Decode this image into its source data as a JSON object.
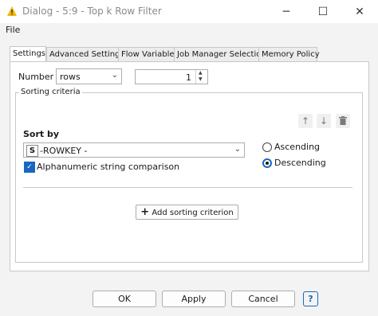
{
  "window": {
    "title": "Dialog - 5:9 - Top k Row Filter",
    "minimize": "─",
    "maximize": "☐",
    "close": "✕"
  },
  "menu": {
    "file": "File"
  },
  "tabs": [
    {
      "label": "Settings"
    },
    {
      "label": "Advanced Settings"
    },
    {
      "label": "Flow Variables"
    },
    {
      "label": "Job Manager Selection"
    },
    {
      "label": "Memory Policy"
    }
  ],
  "settings": {
    "number_of_label": "Number of",
    "number_of_unit": "rows",
    "number_value": "1",
    "sorting_criteria_title": "Sorting criteria",
    "sort_by_label": "Sort by",
    "sort_column_type": "S",
    "sort_column": "-ROWKEY -",
    "alphanumeric_label": "Alphanumeric string comparison",
    "alphanumeric_checked": true,
    "ascending_label": "Ascending",
    "descending_label": "Descending",
    "selected_order": "Descending",
    "add_criterion_label": "Add sorting criterion"
  },
  "buttons": {
    "ok": "OK",
    "apply": "Apply",
    "cancel": "Cancel",
    "help": "?"
  },
  "colors": {
    "accent": "#1a66c2",
    "warning_icon": "#f2b705"
  }
}
